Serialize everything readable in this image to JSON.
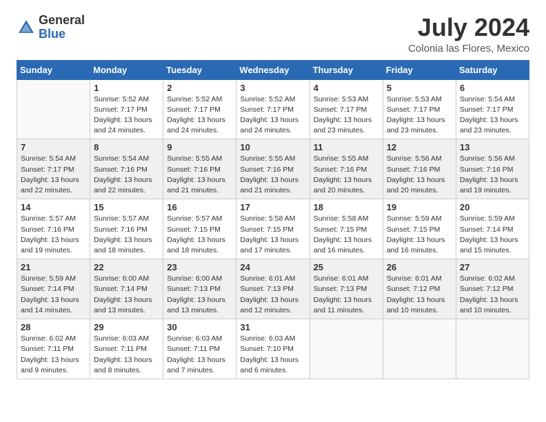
{
  "header": {
    "logo_general": "General",
    "logo_blue": "Blue",
    "month_year": "July 2024",
    "location": "Colonia las Flores, Mexico"
  },
  "columns": [
    "Sunday",
    "Monday",
    "Tuesday",
    "Wednesday",
    "Thursday",
    "Friday",
    "Saturday"
  ],
  "weeks": [
    [
      {
        "day": "",
        "sunrise": "",
        "sunset": "",
        "daylight": ""
      },
      {
        "day": "1",
        "sunrise": "Sunrise: 5:52 AM",
        "sunset": "Sunset: 7:17 PM",
        "daylight": "Daylight: 13 hours and 24 minutes."
      },
      {
        "day": "2",
        "sunrise": "Sunrise: 5:52 AM",
        "sunset": "Sunset: 7:17 PM",
        "daylight": "Daylight: 13 hours and 24 minutes."
      },
      {
        "day": "3",
        "sunrise": "Sunrise: 5:52 AM",
        "sunset": "Sunset: 7:17 PM",
        "daylight": "Daylight: 13 hours and 24 minutes."
      },
      {
        "day": "4",
        "sunrise": "Sunrise: 5:53 AM",
        "sunset": "Sunset: 7:17 PM",
        "daylight": "Daylight: 13 hours and 23 minutes."
      },
      {
        "day": "5",
        "sunrise": "Sunrise: 5:53 AM",
        "sunset": "Sunset: 7:17 PM",
        "daylight": "Daylight: 13 hours and 23 minutes."
      },
      {
        "day": "6",
        "sunrise": "Sunrise: 5:54 AM",
        "sunset": "Sunset: 7:17 PM",
        "daylight": "Daylight: 13 hours and 23 minutes."
      }
    ],
    [
      {
        "day": "7",
        "sunrise": "Sunrise: 5:54 AM",
        "sunset": "Sunset: 7:17 PM",
        "daylight": "Daylight: 13 hours and 22 minutes."
      },
      {
        "day": "8",
        "sunrise": "Sunrise: 5:54 AM",
        "sunset": "Sunset: 7:16 PM",
        "daylight": "Daylight: 13 hours and 22 minutes."
      },
      {
        "day": "9",
        "sunrise": "Sunrise: 5:55 AM",
        "sunset": "Sunset: 7:16 PM",
        "daylight": "Daylight: 13 hours and 21 minutes."
      },
      {
        "day": "10",
        "sunrise": "Sunrise: 5:55 AM",
        "sunset": "Sunset: 7:16 PM",
        "daylight": "Daylight: 13 hours and 21 minutes."
      },
      {
        "day": "11",
        "sunrise": "Sunrise: 5:55 AM",
        "sunset": "Sunset: 7:16 PM",
        "daylight": "Daylight: 13 hours and 20 minutes."
      },
      {
        "day": "12",
        "sunrise": "Sunrise: 5:56 AM",
        "sunset": "Sunset: 7:16 PM",
        "daylight": "Daylight: 13 hours and 20 minutes."
      },
      {
        "day": "13",
        "sunrise": "Sunrise: 5:56 AM",
        "sunset": "Sunset: 7:16 PM",
        "daylight": "Daylight: 13 hours and 19 minutes."
      }
    ],
    [
      {
        "day": "14",
        "sunrise": "Sunrise: 5:57 AM",
        "sunset": "Sunset: 7:16 PM",
        "daylight": "Daylight: 13 hours and 19 minutes."
      },
      {
        "day": "15",
        "sunrise": "Sunrise: 5:57 AM",
        "sunset": "Sunset: 7:16 PM",
        "daylight": "Daylight: 13 hours and 18 minutes."
      },
      {
        "day": "16",
        "sunrise": "Sunrise: 5:57 AM",
        "sunset": "Sunset: 7:15 PM",
        "daylight": "Daylight: 13 hours and 18 minutes."
      },
      {
        "day": "17",
        "sunrise": "Sunrise: 5:58 AM",
        "sunset": "Sunset: 7:15 PM",
        "daylight": "Daylight: 13 hours and 17 minutes."
      },
      {
        "day": "18",
        "sunrise": "Sunrise: 5:58 AM",
        "sunset": "Sunset: 7:15 PM",
        "daylight": "Daylight: 13 hours and 16 minutes."
      },
      {
        "day": "19",
        "sunrise": "Sunrise: 5:59 AM",
        "sunset": "Sunset: 7:15 PM",
        "daylight": "Daylight: 13 hours and 16 minutes."
      },
      {
        "day": "20",
        "sunrise": "Sunrise: 5:59 AM",
        "sunset": "Sunset: 7:14 PM",
        "daylight": "Daylight: 13 hours and 15 minutes."
      }
    ],
    [
      {
        "day": "21",
        "sunrise": "Sunrise: 5:59 AM",
        "sunset": "Sunset: 7:14 PM",
        "daylight": "Daylight: 13 hours and 14 minutes."
      },
      {
        "day": "22",
        "sunrise": "Sunrise: 6:00 AM",
        "sunset": "Sunset: 7:14 PM",
        "daylight": "Daylight: 13 hours and 13 minutes."
      },
      {
        "day": "23",
        "sunrise": "Sunrise: 6:00 AM",
        "sunset": "Sunset: 7:13 PM",
        "daylight": "Daylight: 13 hours and 13 minutes."
      },
      {
        "day": "24",
        "sunrise": "Sunrise: 6:01 AM",
        "sunset": "Sunset: 7:13 PM",
        "daylight": "Daylight: 13 hours and 12 minutes."
      },
      {
        "day": "25",
        "sunrise": "Sunrise: 6:01 AM",
        "sunset": "Sunset: 7:13 PM",
        "daylight": "Daylight: 13 hours and 11 minutes."
      },
      {
        "day": "26",
        "sunrise": "Sunrise: 6:01 AM",
        "sunset": "Sunset: 7:12 PM",
        "daylight": "Daylight: 13 hours and 10 minutes."
      },
      {
        "day": "27",
        "sunrise": "Sunrise: 6:02 AM",
        "sunset": "Sunset: 7:12 PM",
        "daylight": "Daylight: 13 hours and 10 minutes."
      }
    ],
    [
      {
        "day": "28",
        "sunrise": "Sunrise: 6:02 AM",
        "sunset": "Sunset: 7:11 PM",
        "daylight": "Daylight: 13 hours and 9 minutes."
      },
      {
        "day": "29",
        "sunrise": "Sunrise: 6:03 AM",
        "sunset": "Sunset: 7:11 PM",
        "daylight": "Daylight: 13 hours and 8 minutes."
      },
      {
        "day": "30",
        "sunrise": "Sunrise: 6:03 AM",
        "sunset": "Sunset: 7:11 PM",
        "daylight": "Daylight: 13 hours and 7 minutes."
      },
      {
        "day": "31",
        "sunrise": "Sunrise: 6:03 AM",
        "sunset": "Sunset: 7:10 PM",
        "daylight": "Daylight: 13 hours and 6 minutes."
      },
      {
        "day": "",
        "sunrise": "",
        "sunset": "",
        "daylight": ""
      },
      {
        "day": "",
        "sunrise": "",
        "sunset": "",
        "daylight": ""
      },
      {
        "day": "",
        "sunrise": "",
        "sunset": "",
        "daylight": ""
      }
    ]
  ]
}
